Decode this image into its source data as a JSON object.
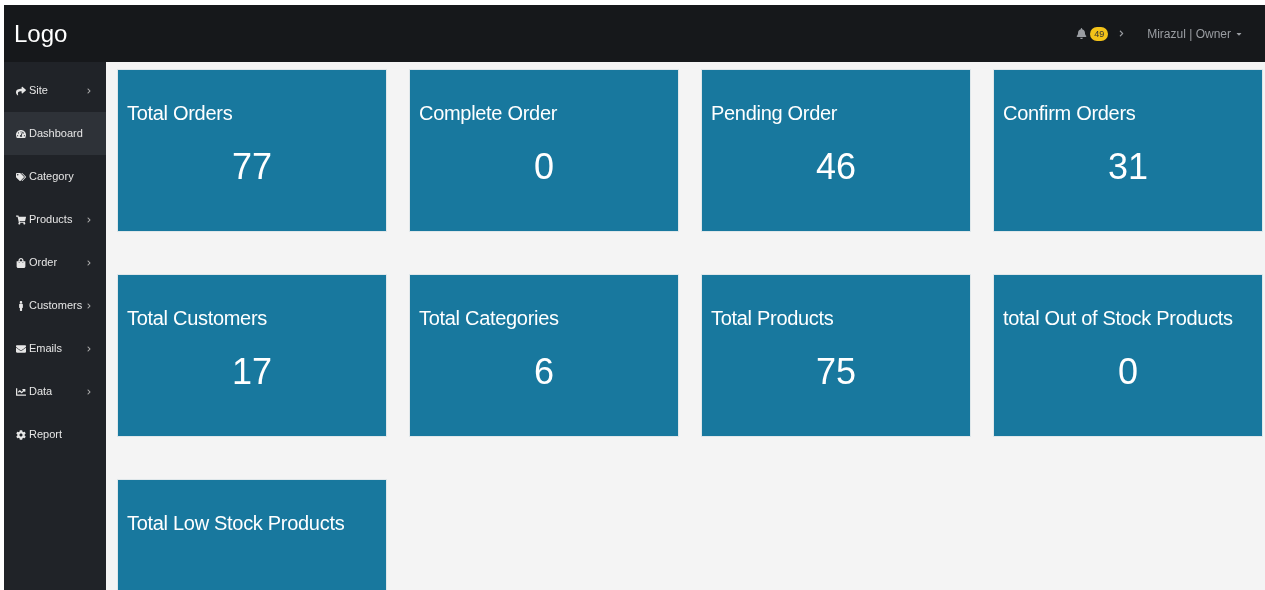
{
  "topbar": {
    "logo": "Logo",
    "notification_count": "49",
    "user": "Mirazul | Owner"
  },
  "sidebar": {
    "items": [
      {
        "label": "Site",
        "kind": "share",
        "has_submenu": true,
        "selected": false
      },
      {
        "label": "Dashboard",
        "kind": "dashboard",
        "has_submenu": false,
        "selected": true
      },
      {
        "label": "Category",
        "kind": "tags",
        "has_submenu": false,
        "selected": false
      },
      {
        "label": "Products",
        "kind": "cart",
        "has_submenu": true,
        "selected": false
      },
      {
        "label": "Order",
        "kind": "bag",
        "has_submenu": true,
        "selected": false
      },
      {
        "label": "Customers",
        "kind": "person",
        "has_submenu": true,
        "selected": false
      },
      {
        "label": "Emails",
        "kind": "envelope",
        "has_submenu": true,
        "selected": false
      },
      {
        "label": "Data",
        "kind": "chart",
        "has_submenu": true,
        "selected": false
      },
      {
        "label": "Report",
        "kind": "gear",
        "has_submenu": false,
        "selected": false
      }
    ]
  },
  "cards": [
    {
      "title": "Total Orders",
      "value": "77"
    },
    {
      "title": "Complete Order",
      "value": "0"
    },
    {
      "title": "Pending Order",
      "value": "46"
    },
    {
      "title": "Confirm Orders",
      "value": "31"
    },
    {
      "title": "Total Customers",
      "value": "17"
    },
    {
      "title": "Total Categories",
      "value": "6"
    },
    {
      "title": "Total Products",
      "value": "75"
    },
    {
      "title": "total Out of Stock Products",
      "value": "0"
    },
    {
      "title": "Total Low Stock Products"
    }
  ]
}
